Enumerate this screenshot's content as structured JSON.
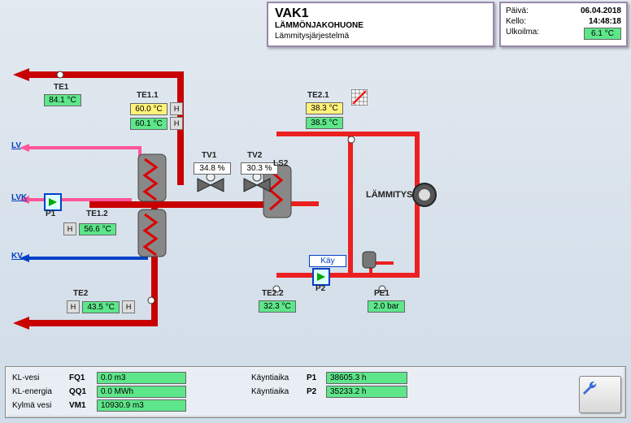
{
  "header": {
    "title": "VAK1",
    "sub": "LÄMMÖNJAKOHUONE",
    "desc": "Lämmitysjärjestelmä"
  },
  "clock": {
    "date_lbl": "Päivä:",
    "date": "06.04.2018",
    "time_lbl": "Kello:",
    "time": "14:48:18",
    "out_lbl": "Ulkoilma:",
    "out": "6.1 °C"
  },
  "nodes": {
    "te1": {
      "lbl": "TE1",
      "val": "84.1 °C"
    },
    "te11": {
      "lbl": "TE1.1",
      "sp": "60.0 °C",
      "pv": "60.1 °C"
    },
    "te12": {
      "lbl": "TE1.2",
      "val": "56.6 °C"
    },
    "te2": {
      "lbl": "TE2",
      "val": "43.5 °C"
    },
    "te21": {
      "lbl": "TE2.1",
      "sp": "38.3 °C",
      "pv": "38.5 °C"
    },
    "te22": {
      "lbl": "TE2.2",
      "val": "32.3 °C"
    },
    "tv1": {
      "lbl": "TV1",
      "val": "34.8 %"
    },
    "tv2": {
      "lbl": "TV2",
      "val": "30.3 %"
    },
    "pe1": {
      "lbl": "PE1",
      "val": "2.0 bar"
    },
    "ls2": {
      "lbl": "LS2"
    },
    "p1": {
      "lbl": "P1"
    },
    "p2": {
      "lbl": "P2",
      "state": "Käy"
    },
    "heating": "LÄMMITYS",
    "lv": "LV",
    "lvk": "LVK",
    "kv": "KV",
    "h": "H"
  },
  "south": {
    "kl_vesi_lbl": "KL-vesi",
    "kl_vesi_tag": "FQ1",
    "kl_vesi": "0.0 m3",
    "kl_en_lbl": "KL-energia",
    "kl_en_tag": "QQ1",
    "kl_en": "0.0 MWh",
    "kylma_lbl": "Kylmä vesi",
    "kylma_tag": "VM1",
    "kylma": "10930.9 m3",
    "run_lbl": "Käyntiaika",
    "p1_tag": "P1",
    "p1": "38605.3 h",
    "p2_tag": "P2",
    "p2": "35233.2 h"
  }
}
